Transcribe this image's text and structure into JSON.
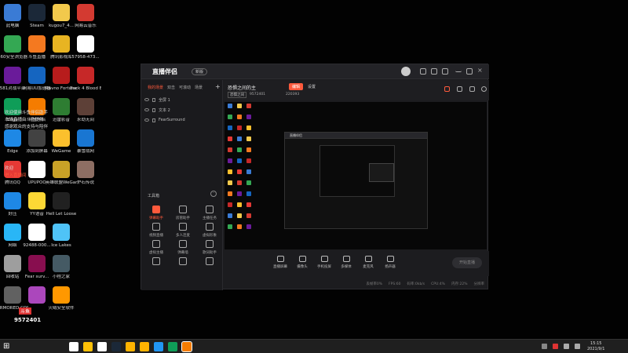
{
  "desktop": {
    "icons": [
      {
        "label": "此电脑",
        "color": "#3a7bd5",
        "col": 0,
        "row": 0
      },
      {
        "label": "Steam",
        "color": "#1b2838",
        "col": 1,
        "row": 0
      },
      {
        "label": "kugou7_4...",
        "color": "#f2c94c",
        "col": 2,
        "row": 0
      },
      {
        "label": "网易云音乐",
        "color": "#d33a31",
        "col": 3,
        "row": 0
      },
      {
        "label": "360安全浏览器",
        "color": "#34a853",
        "col": 0,
        "row": 1
      },
      {
        "label": "斗鱼直播",
        "color": "#f47920",
        "col": 1,
        "row": 1
      },
      {
        "label": "腾讯影视库",
        "color": "#e8b422",
        "col": 2,
        "row": 1
      },
      {
        "label": "57958-473...",
        "color": "#ffffff",
        "col": 3,
        "row": 1
      },
      {
        "label": "581对战平台",
        "color": "#6a1b9a",
        "col": 0,
        "row": 2
      },
      {
        "label": "网易UU加速器",
        "color": "#1565c0",
        "col": 1,
        "row": 2
      },
      {
        "label": "Ravno Fortune - ...",
        "color": "#b71c1c",
        "col": 2,
        "row": 2
      },
      {
        "label": "Back 4 Blood Beta",
        "color": "#c62828",
        "col": 3,
        "row": 2
      },
      {
        "label": "Edge",
        "color": "#0f9d58",
        "col": 0,
        "row": 3
      },
      {
        "label": "斗鱼伴侣",
        "color": "#f57c00",
        "col": 1,
        "row": 3
      },
      {
        "label": "迅雷影音",
        "color": "#2e7d32",
        "col": 2,
        "row": 3
      },
      {
        "label": "永劫无间",
        "color": "#5d4037",
        "col": 3,
        "row": 3
      },
      {
        "label": "Edge",
        "color": "#1e88e5",
        "col": 0,
        "row": 4
      },
      {
        "label": "添加到屏幕",
        "color": "#424242",
        "col": 1,
        "row": 4
      },
      {
        "label": "WeGame",
        "color": "#fbc02d",
        "col": 2,
        "row": 4
      },
      {
        "label": "暴雪战网",
        "color": "#1976d2",
        "col": 3,
        "row": 4
      },
      {
        "label": "腾讯QQ",
        "color": "#e53935",
        "col": 0,
        "row": 5
      },
      {
        "label": "UPUPOO",
        "color": "#ffffff",
        "col": 1,
        "row": 5
      },
      {
        "label": "英雄联盟WeGame版",
        "color": "#c9a227",
        "col": 2,
        "row": 5
      },
      {
        "label": "炉石传说",
        "color": "#8d6e63",
        "col": 3,
        "row": 5
      },
      {
        "label": "好压",
        "color": "#1e88e5",
        "col": 0,
        "row": 6
      },
      {
        "label": "YY语音",
        "color": "#fdd835",
        "col": 1,
        "row": 6
      },
      {
        "label": "Hell Let Loose",
        "color": "#212121",
        "col": 2,
        "row": 6
      },
      {
        "label": "网络",
        "color": "#29b6f6",
        "col": 0,
        "row": 7
      },
      {
        "label": "92488-000...",
        "color": "#ffffff",
        "col": 1,
        "row": 7
      },
      {
        "label": "Ice Lakes",
        "color": "#4fc3f7",
        "col": 2,
        "row": 7
      },
      {
        "label": "回收站",
        "color": "#9e9e9e",
        "col": 0,
        "row": 8
      },
      {
        "label": "Fear surv...",
        "color": "#880e4f",
        "col": 1,
        "row": 8
      },
      {
        "label": "小程之家",
        "color": "#455a64",
        "col": 2,
        "row": 8
      },
      {
        "label": "ARMORED CORE",
        "color": "#616161",
        "col": 0,
        "row": 9
      },
      {
        "label": "",
        "color": "#ab47bc",
        "col": 1,
        "row": 9
      },
      {
        "label": "火绒安全软件",
        "color": "#ff9800",
        "col": 2,
        "row": 9
      }
    ],
    "overlay_lines": [
      {
        "text": "欢迎使用斗鱼伴侣助手",
        "highlight": false
      },
      {
        "text": "本场直播由斗鱼提供",
        "highlight": false
      },
      {
        "text": "感谢观众的支持与陪伴",
        "highlight": false
      },
      {
        "text": "欢迎",
        "highlight": false
      },
      {
        "text": "进入直播间",
        "highlight": true
      }
    ],
    "badge": {
      "logo": "斗鱼",
      "room_id": "9572401"
    }
  },
  "app": {
    "title": "直播伴侣",
    "version_label": "新版",
    "scene_tabs": [
      "我的场景",
      "双击",
      "可滚动",
      "场景"
    ],
    "sources": [
      {
        "name": "全屏 1"
      },
      {
        "name": "文本 2"
      },
      {
        "name": "FearSurround"
      }
    ],
    "toolbox_title": "工具箱",
    "tools": [
      {
        "label": "弹幕助手",
        "active": true
      },
      {
        "label": "房管助手",
        "active": false
      },
      {
        "label": "主播任务",
        "active": false
      },
      {
        "label": "视频直播",
        "active": false
      },
      {
        "label": "多人连麦",
        "active": false
      },
      {
        "label": "虚拟形象",
        "active": false
      },
      {
        "label": "虚拟主播",
        "active": false
      },
      {
        "label": "弹幕墙",
        "active": false
      },
      {
        "label": "歌词助手",
        "active": false
      },
      {
        "label": "",
        "active": false
      },
      {
        "label": "",
        "active": false
      },
      {
        "label": "",
        "active": false
      }
    ],
    "room_title": "恐惧之间的主",
    "edit_label": "编辑",
    "settings_label": "设置",
    "category": "恐惧之间",
    "room_id_text": "9572401",
    "hot_value": "220393",
    "nested_title": "直播伴侣",
    "bottom_buttons": [
      {
        "label": "直播屏幕"
      },
      {
        "label": "摄像头"
      },
      {
        "label": "手机投屏"
      },
      {
        "label": "多媒体"
      },
      {
        "label": "麦克风"
      },
      {
        "label": "扬声器"
      }
    ],
    "start_label": "开始直播",
    "status_items": [
      "丢帧率0%",
      "FPS:60",
      "码率:0kb/s",
      "CPU:4%",
      "内存:22%",
      "分辨率"
    ]
  },
  "taskbar": {
    "time": "15:15",
    "date": "2021/9/1",
    "app_colors": [
      "#ffffff",
      "#ffc107",
      "#ffffff",
      "#1b2838",
      "#ffb300",
      "#ffb300",
      "#2196f3",
      "#0f9d58",
      "#f57c00"
    ]
  }
}
